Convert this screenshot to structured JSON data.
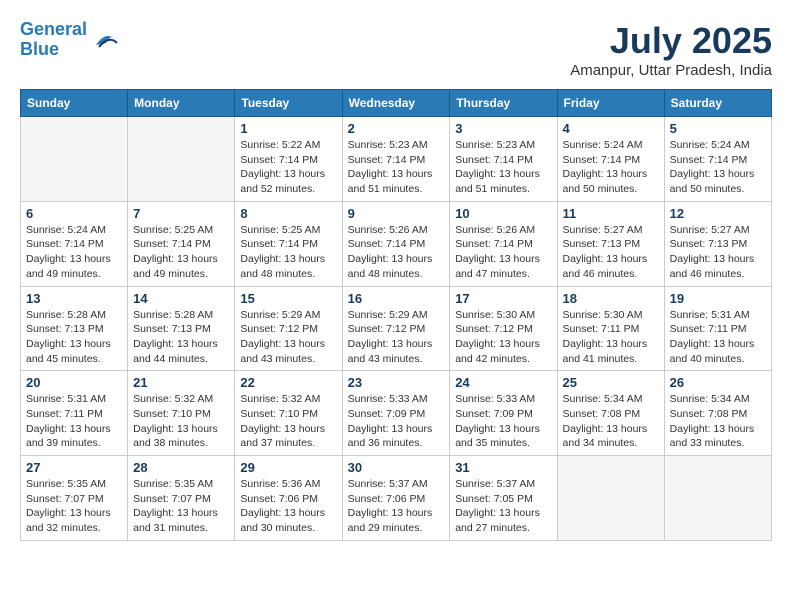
{
  "header": {
    "logo_line1": "General",
    "logo_line2": "Blue",
    "month": "July 2025",
    "location": "Amanpur, Uttar Pradesh, India"
  },
  "weekdays": [
    "Sunday",
    "Monday",
    "Tuesday",
    "Wednesday",
    "Thursday",
    "Friday",
    "Saturday"
  ],
  "weeks": [
    [
      {
        "day": "",
        "info": ""
      },
      {
        "day": "",
        "info": ""
      },
      {
        "day": "1",
        "info": "Sunrise: 5:22 AM\nSunset: 7:14 PM\nDaylight: 13 hours and 52 minutes."
      },
      {
        "day": "2",
        "info": "Sunrise: 5:23 AM\nSunset: 7:14 PM\nDaylight: 13 hours and 51 minutes."
      },
      {
        "day": "3",
        "info": "Sunrise: 5:23 AM\nSunset: 7:14 PM\nDaylight: 13 hours and 51 minutes."
      },
      {
        "day": "4",
        "info": "Sunrise: 5:24 AM\nSunset: 7:14 PM\nDaylight: 13 hours and 50 minutes."
      },
      {
        "day": "5",
        "info": "Sunrise: 5:24 AM\nSunset: 7:14 PM\nDaylight: 13 hours and 50 minutes."
      }
    ],
    [
      {
        "day": "6",
        "info": "Sunrise: 5:24 AM\nSunset: 7:14 PM\nDaylight: 13 hours and 49 minutes."
      },
      {
        "day": "7",
        "info": "Sunrise: 5:25 AM\nSunset: 7:14 PM\nDaylight: 13 hours and 49 minutes."
      },
      {
        "day": "8",
        "info": "Sunrise: 5:25 AM\nSunset: 7:14 PM\nDaylight: 13 hours and 48 minutes."
      },
      {
        "day": "9",
        "info": "Sunrise: 5:26 AM\nSunset: 7:14 PM\nDaylight: 13 hours and 48 minutes."
      },
      {
        "day": "10",
        "info": "Sunrise: 5:26 AM\nSunset: 7:14 PM\nDaylight: 13 hours and 47 minutes."
      },
      {
        "day": "11",
        "info": "Sunrise: 5:27 AM\nSunset: 7:13 PM\nDaylight: 13 hours and 46 minutes."
      },
      {
        "day": "12",
        "info": "Sunrise: 5:27 AM\nSunset: 7:13 PM\nDaylight: 13 hours and 46 minutes."
      }
    ],
    [
      {
        "day": "13",
        "info": "Sunrise: 5:28 AM\nSunset: 7:13 PM\nDaylight: 13 hours and 45 minutes."
      },
      {
        "day": "14",
        "info": "Sunrise: 5:28 AM\nSunset: 7:13 PM\nDaylight: 13 hours and 44 minutes."
      },
      {
        "day": "15",
        "info": "Sunrise: 5:29 AM\nSunset: 7:12 PM\nDaylight: 13 hours and 43 minutes."
      },
      {
        "day": "16",
        "info": "Sunrise: 5:29 AM\nSunset: 7:12 PM\nDaylight: 13 hours and 43 minutes."
      },
      {
        "day": "17",
        "info": "Sunrise: 5:30 AM\nSunset: 7:12 PM\nDaylight: 13 hours and 42 minutes."
      },
      {
        "day": "18",
        "info": "Sunrise: 5:30 AM\nSunset: 7:11 PM\nDaylight: 13 hours and 41 minutes."
      },
      {
        "day": "19",
        "info": "Sunrise: 5:31 AM\nSunset: 7:11 PM\nDaylight: 13 hours and 40 minutes."
      }
    ],
    [
      {
        "day": "20",
        "info": "Sunrise: 5:31 AM\nSunset: 7:11 PM\nDaylight: 13 hours and 39 minutes."
      },
      {
        "day": "21",
        "info": "Sunrise: 5:32 AM\nSunset: 7:10 PM\nDaylight: 13 hours and 38 minutes."
      },
      {
        "day": "22",
        "info": "Sunrise: 5:32 AM\nSunset: 7:10 PM\nDaylight: 13 hours and 37 minutes."
      },
      {
        "day": "23",
        "info": "Sunrise: 5:33 AM\nSunset: 7:09 PM\nDaylight: 13 hours and 36 minutes."
      },
      {
        "day": "24",
        "info": "Sunrise: 5:33 AM\nSunset: 7:09 PM\nDaylight: 13 hours and 35 minutes."
      },
      {
        "day": "25",
        "info": "Sunrise: 5:34 AM\nSunset: 7:08 PM\nDaylight: 13 hours and 34 minutes."
      },
      {
        "day": "26",
        "info": "Sunrise: 5:34 AM\nSunset: 7:08 PM\nDaylight: 13 hours and 33 minutes."
      }
    ],
    [
      {
        "day": "27",
        "info": "Sunrise: 5:35 AM\nSunset: 7:07 PM\nDaylight: 13 hours and 32 minutes."
      },
      {
        "day": "28",
        "info": "Sunrise: 5:35 AM\nSunset: 7:07 PM\nDaylight: 13 hours and 31 minutes."
      },
      {
        "day": "29",
        "info": "Sunrise: 5:36 AM\nSunset: 7:06 PM\nDaylight: 13 hours and 30 minutes."
      },
      {
        "day": "30",
        "info": "Sunrise: 5:37 AM\nSunset: 7:06 PM\nDaylight: 13 hours and 29 minutes."
      },
      {
        "day": "31",
        "info": "Sunrise: 5:37 AM\nSunset: 7:05 PM\nDaylight: 13 hours and 27 minutes."
      },
      {
        "day": "",
        "info": ""
      },
      {
        "day": "",
        "info": ""
      }
    ]
  ]
}
